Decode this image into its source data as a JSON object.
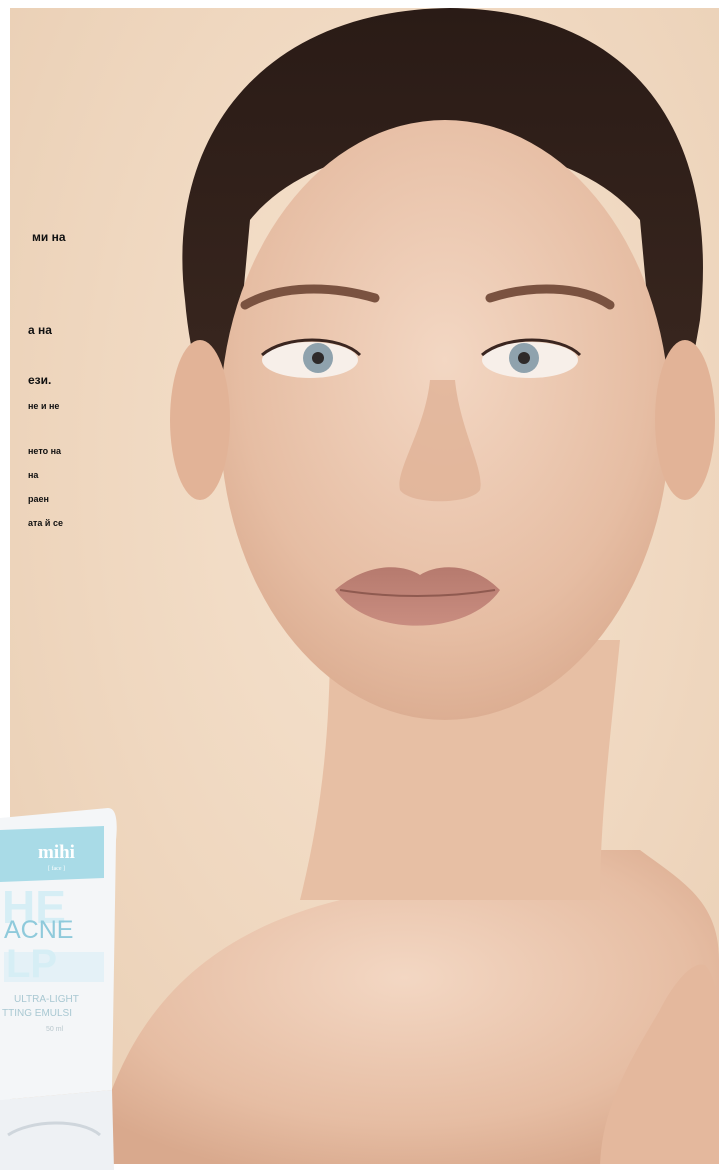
{
  "hero": {
    "text_fragments": [
      "ми на",
      "а на",
      "ези.",
      "не и не",
      "нето на",
      "на",
      "раен",
      "ата й се"
    ]
  },
  "product": {
    "brand": "mihi",
    "brand_sub": "[ face ]",
    "name_big": "HE",
    "name_acne": "ACNE",
    "name_big2": "LP",
    "descriptor_line1": "ULTRA-LIGHT",
    "descriptor_line2": "TTING EMULSI",
    "volume": "50 ml"
  },
  "colors": {
    "background": "#efd9c3",
    "tube_white": "#f4f6f8",
    "tube_accent": "#a9dbe7",
    "text": "#111111"
  }
}
